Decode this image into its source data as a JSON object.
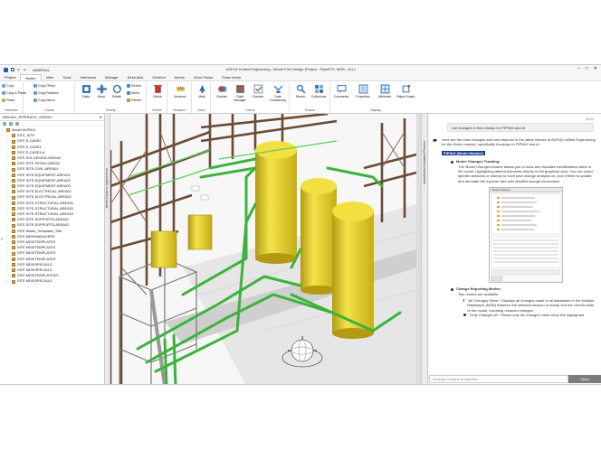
{
  "titlebar": {
    "profile": "GENERAL",
    "title": "AVEVA Unified Engineering - Model E3D Design (Project - PipeETS, MDB - ALL)"
  },
  "tabs": [
    "Project",
    "Home",
    "View",
    "Tools",
    "Interfaces",
    "Manage",
    "Desk Aids",
    "General",
    "Admin",
    "Work Packs",
    "Draw Home"
  ],
  "active_tab": "Home",
  "ribbon": {
    "selection": {
      "label": "Selection",
      "items": [
        "Copy",
        "Copy & Paste",
        "Paste"
      ]
    },
    "create": {
      "label": "Create",
      "items": [
        "Copy Offset",
        "Copy Rotation",
        "Copy Mirror"
      ]
    },
    "modify": {
      "label": "Modify",
      "buttons": [
        "Editor",
        "Move",
        "Rotate"
      ],
      "items": [
        "Stretch",
        "Mirror",
        "Painter"
      ]
    },
    "delete": {
      "label": "Delete",
      "buttons": [
        "Delete"
      ]
    },
    "measure": {
      "label": "Measure",
      "buttons": [
        "Measure"
      ]
    },
    "mark": {
      "label": "Mark",
      "buttons": [
        "Mark"
      ]
    },
    "check": {
      "label": "Check",
      "buttons": [
        "Clashes",
        "Clash Manager",
        "Checker",
        "Data Consistency"
      ]
    },
    "search": {
      "label": "Search",
      "buttons": [
        "Search",
        "Collections"
      ]
    },
    "display": {
      "label": "Display",
      "buttons": [
        "Comments",
        "Properties",
        "Attributes",
        "Object Snaps"
      ]
    }
  },
  "leftpanel": {
    "header": "AREA01_PIPERACK_GRID01",
    "root": "Model WORLD",
    "items": [
      "SITE_SITE",
      "SITE E-CASE2",
      "SITE E-CASE3",
      "SITE E-CASE3-N",
      "SITE E01-DEMOS-GRID4A",
      "SITE SITE-PIPING-AREA0",
      "SITE SITE-CIVIL-AREA01",
      "SITE SITE-EQUIPMENT-AREA01",
      "SITE SITE-EQUIPMENT-AREA02",
      "SITE SITE-EQUIPMENT-AREA03",
      "SITE SITE-ELECTRICAL-AREA01",
      "SITE SITE-ELECTRICAL-AREA02",
      "SITE SITE-STRUCTURAL-AREA01",
      "SITE SITE-STRUCTURAL-AREA02",
      "SITE SITE-STRUCTURAL-AREA03",
      "SITE SITE-SUPPORTS-AREA01",
      "SITE SITE-SUPPORTS-AREA02",
      "SITE Model_Templates_Site",
      "SITE MDS/MANAGERS",
      "SITE MDS/TEMPLATES",
      "SITE MDS/TEMPLATES",
      "SITE MDS/TEMPLATES",
      "SITE MDS/TEMPLATES",
      "SITE MDS/SPECIALS",
      "SITE MDS/SPECIALS",
      "SITE MDS/TEMPLATES/0",
      "SITE MDS/SPECIALS"
    ]
  },
  "leftsidetab": "Model Explorer  Appearance",
  "rightsidetab": "Industrial AI Assistant Preview",
  "chat": {
    "timestamp": "16:20",
    "user_message": "List changes in this release for PIPING and AI",
    "ai_intro": "Here are the main changes and new features in the latest release of AVEVA Unified Engineering for the Model module, specifically focusing on PIPING and AI.",
    "highlight": "PIPING (Model Module)",
    "section1_title": "Model Changes Tracking:",
    "section1_text": "The Model Changes feature allows you to track and visualize modifications within a 3D model, highlighting altered elements directly in the graphical view. You can select specific sessions or stamps to have your change analysis on, and refresh to update and annotate the explorer tree with detailed change information.",
    "screenshot_title": "Model Changes",
    "section2_title": "Change Reporting Modes:",
    "section2_intro": "Two modes are available:",
    "section2_bullet1": "\"All Changes Since\": Displays all changes made in all databases in the Multiple Databases (MDB) between the selected session or stamp and the current state of the model, including unsaved changes.",
    "section2_bullet2": "\"Only Changes At\": Shows only the changes made since the highlighted",
    "input_placeholder": "Message Industrial AI Assistant",
    "send_label": "Send"
  }
}
